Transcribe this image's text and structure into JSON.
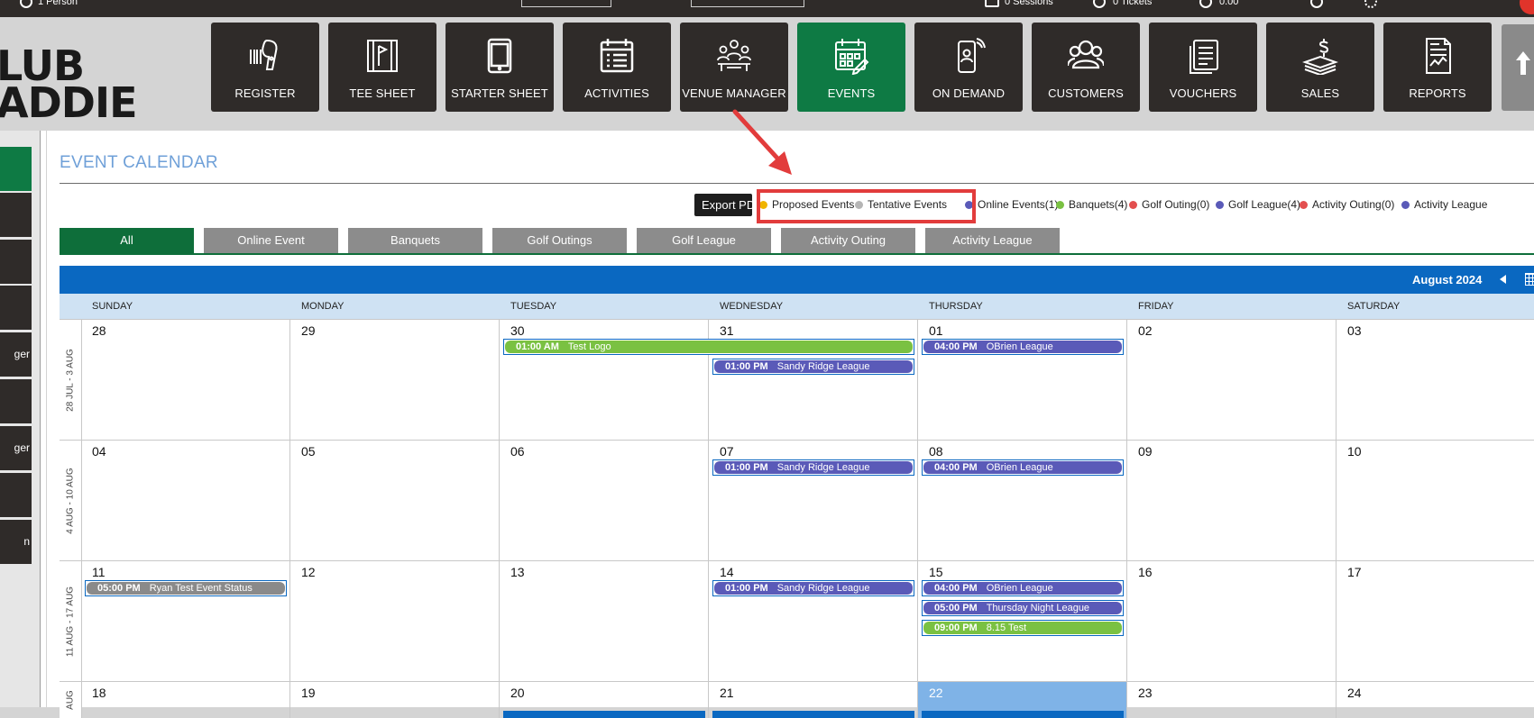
{
  "topbar": {
    "item1": "1 Person",
    "item2": "0 Sessions",
    "item3": "0 Tickets",
    "item4": "0.00"
  },
  "logo": {
    "line1": "LUB",
    "line2": "ADDIE"
  },
  "nav": [
    {
      "label": "REGISTER",
      "icon": "barcode-scanner-icon"
    },
    {
      "label": "TEE SHEET",
      "icon": "tee-sheet-icon"
    },
    {
      "label": "STARTER SHEET",
      "icon": "tablet-icon"
    },
    {
      "label": "ACTIVITIES",
      "icon": "calendar-list-icon"
    },
    {
      "label": "VENUE MANAGER",
      "icon": "venue-meeting-icon"
    },
    {
      "label": "EVENTS",
      "icon": "calendar-edit-icon",
      "active": true
    },
    {
      "label": "ON DEMAND",
      "icon": "mobile-person-icon"
    },
    {
      "label": "CUSTOMERS",
      "icon": "users-icon"
    },
    {
      "label": "VOUCHERS",
      "icon": "vouchers-icon"
    },
    {
      "label": "SALES",
      "icon": "money-icon"
    },
    {
      "label": "REPORTS",
      "icon": "report-chart-icon"
    }
  ],
  "sidebar": {
    "items": [
      {
        "label": "",
        "active": true
      },
      {
        "label": ""
      },
      {
        "label": ""
      },
      {
        "label": ""
      },
      {
        "label": "ger"
      },
      {
        "label": ""
      },
      {
        "label": "ger"
      },
      {
        "label": ""
      },
      {
        "label": "n"
      }
    ]
  },
  "page": {
    "title": "EVENT CALENDAR",
    "export_label": "Export PDF"
  },
  "legend": [
    {
      "label": "Proposed Events",
      "color": "#f0b400"
    },
    {
      "label": "Tentative Events",
      "color": "#b5b5b5"
    },
    {
      "label": "Online Events(1)",
      "color": "#5a5ab8"
    },
    {
      "label": "Banquets(4)",
      "color": "#7ac142"
    },
    {
      "label": "Golf Outing(0)",
      "color": "#e34f4f"
    },
    {
      "label": "Golf League(4)",
      "color": "#5a5ab8"
    },
    {
      "label": "Activity Outing(0)",
      "color": "#e34f4f"
    },
    {
      "label": "Activity League",
      "color": "#5a5ab8"
    }
  ],
  "filter_tabs": [
    "All",
    "Online Event",
    "Banquets",
    "Golf Outings",
    "Golf League",
    "Activity Outing",
    "Activity League"
  ],
  "calendar": {
    "month_label": "August 2024",
    "days": [
      "SUNDAY",
      "MONDAY",
      "TUESDAY",
      "WEDNESDAY",
      "THURSDAY",
      "FRIDAY",
      "SATURDAY"
    ],
    "weeks": [
      {
        "label": "28 JUL - 3 AUG",
        "dates": [
          "28",
          "29",
          "30",
          "31",
          "01",
          "02",
          "03"
        ]
      },
      {
        "label": "4 AUG - 10 AUG",
        "dates": [
          "04",
          "05",
          "06",
          "07",
          "08",
          "09",
          "10"
        ]
      },
      {
        "label": "11 AUG - 17 AUG",
        "dates": [
          "11",
          "12",
          "13",
          "14",
          "15",
          "16",
          "17"
        ]
      },
      {
        "label": "AUG",
        "dates": [
          "18",
          "19",
          "20",
          "21",
          "22",
          "23",
          "24"
        ]
      }
    ],
    "events": {
      "test_logo": {
        "time": "01:00 AM",
        "title": "Test Logo",
        "color": "#7ac142"
      },
      "sandy_ridge": {
        "time": "01:00 PM",
        "title": "Sandy Ridge League",
        "color": "#5a5ab8"
      },
      "obrien": {
        "time": "04:00 PM",
        "title": "OBrien League",
        "color": "#5a5ab8"
      },
      "ryan": {
        "time": "05:00 PM",
        "title": "Ryan Test Event Status",
        "color": "#8a8a8a"
      },
      "thursday_night": {
        "time": "05:00 PM",
        "title": "Thursday Night League",
        "color": "#5a5ab8"
      },
      "test_815": {
        "time": "09:00 PM",
        "title": "8.15 Test",
        "color": "#7ac142"
      }
    }
  },
  "colors": {
    "accent_green": "#0e7a44",
    "calendar_blue": "#0a68c1",
    "highlight_red": "#e23c3c"
  }
}
